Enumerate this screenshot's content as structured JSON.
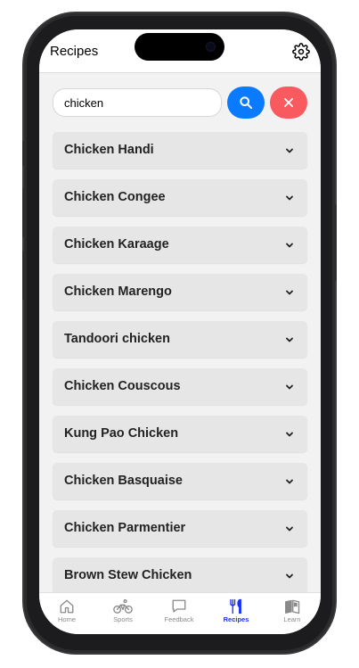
{
  "header": {
    "title": "Recipes",
    "settings_icon": "gear-icon"
  },
  "search": {
    "value": "chicken",
    "placeholder": ""
  },
  "buttons": {
    "search_icon": "search-icon",
    "clear_icon": "close-icon",
    "search_color": "#0a7aff",
    "clear_color": "#f85a5f"
  },
  "recipes": [
    {
      "label": "Chicken Handi"
    },
    {
      "label": "Chicken Congee"
    },
    {
      "label": "Chicken Karaage"
    },
    {
      "label": "Chicken Marengo"
    },
    {
      "label": "Tandoori chicken"
    },
    {
      "label": "Chicken Couscous"
    },
    {
      "label": "Kung Pao Chicken"
    },
    {
      "label": "Chicken Basquaise"
    },
    {
      "label": "Chicken Parmentier"
    },
    {
      "label": "Brown Stew Chicken"
    }
  ],
  "tabs": [
    {
      "label": "Home",
      "icon": "home-icon",
      "active": false
    },
    {
      "label": "Sports",
      "icon": "bicycle-icon",
      "active": false
    },
    {
      "label": "Feedback",
      "icon": "chat-bubble-icon",
      "active": false
    },
    {
      "label": "Recipes",
      "icon": "fork-knife-icon",
      "active": true
    },
    {
      "label": "Learn",
      "icon": "book-icon",
      "active": false
    }
  ],
  "colors": {
    "active_tab": "#1630ff",
    "inactive_tab": "#8a8a8a"
  }
}
